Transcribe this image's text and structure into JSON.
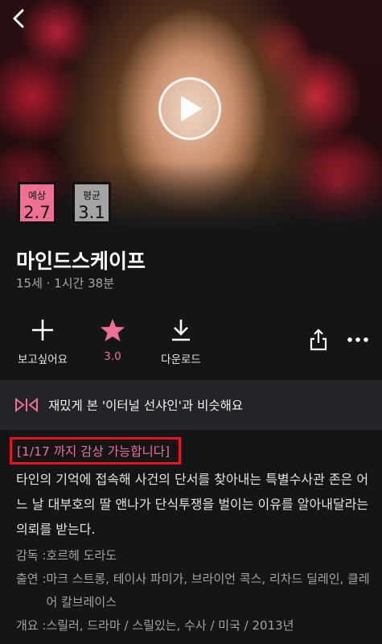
{
  "scores": {
    "expected_label": "예상",
    "expected_value": "2.7",
    "average_label": "평균",
    "average_value": "3.1"
  },
  "movie": {
    "title": "마인드스케이프",
    "meta": "15세 · 1시간 38분"
  },
  "actions": {
    "want_label": "보고싶어요",
    "rating_label": "3.0",
    "download_label": "다운로드"
  },
  "similar": {
    "text": "재밌게 본 '이터널 선샤인'과 비슷해요"
  },
  "availability": "[1/17 까지 감상 가능합니다]",
  "description": "타인의 기억에 접속해 사건의 단서를 찾아내는 특별수사관 존은 어느 날 대부호의 딸 앤나가 단식투쟁을 벌이는 이유를 알아내달라는 의뢰를 받는다.",
  "credits": {
    "director_key": "감독 : ",
    "director_value": "호르헤 도라도",
    "cast_key": "출연 : ",
    "cast_value": "마크 스트롱, 테이사 파미가, 브라이언 콕스, 리차드 딜레인, 클레어 칼브레이스",
    "summary_key": "개요 : ",
    "summary_value": "스릴러, 드라마 / 스릴있는, 수사 / 미국 / 2013년"
  },
  "colors": {
    "background": "#141517",
    "accent_pink": "#ee7092",
    "highlight_red": "#e8141f",
    "bar_bg": "#232427"
  },
  "icons": [
    "back-arrow-icon",
    "play-icon",
    "plus-icon",
    "star-icon",
    "download-icon",
    "share-icon",
    "more-icon",
    "similar-icon"
  ]
}
